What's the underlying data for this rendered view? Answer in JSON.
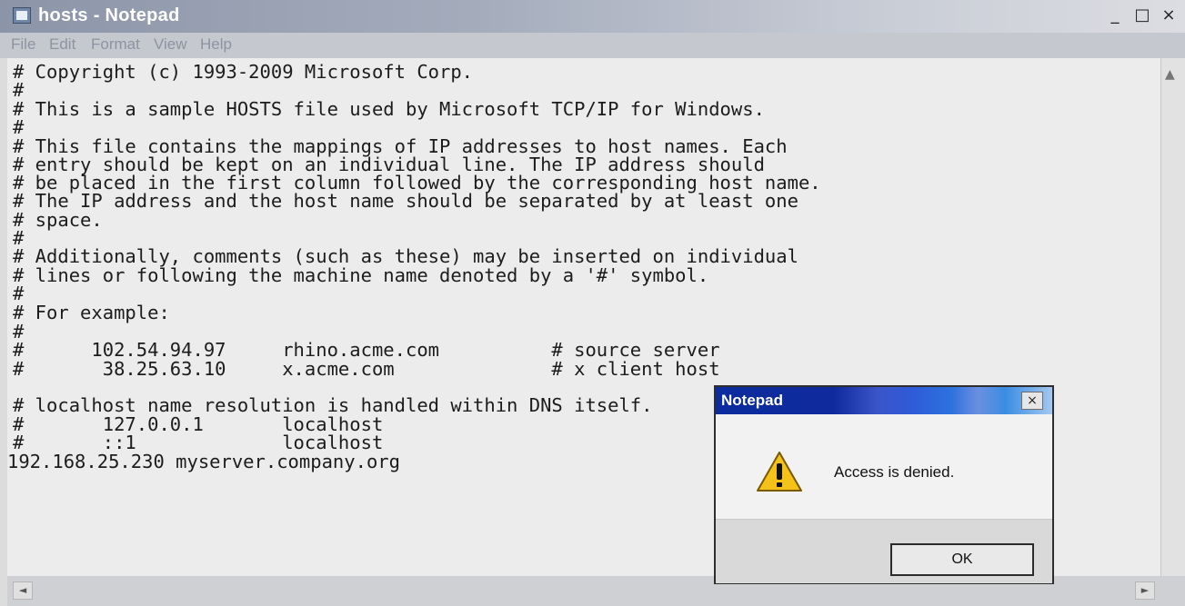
{
  "window": {
    "title": "hosts - Notepad",
    "controls": {
      "minimize": "_",
      "maximize": "□",
      "close": "×"
    }
  },
  "menu": [
    "File",
    "Edit",
    "Format",
    "View",
    "Help"
  ],
  "editor": {
    "lines": [
      "# Copyright (c) 1993-2009 Microsoft Corp.",
      "#",
      "# This is a sample HOSTS file used by Microsoft TCP/IP for Windows.",
      "#",
      "# This file contains the mappings of IP addresses to host names. Each",
      "# entry should be kept on an individual line. The IP address should",
      "# be placed in the first column followed by the corresponding host name.",
      "# The IP address and the host name should be separated by at least one",
      "# space.",
      "#",
      "# Additionally, comments (such as these) may be inserted on individual",
      "# lines or following the machine name denoted by a '#' symbol.",
      "#",
      "# For example:",
      "#",
      "#      102.54.94.97     rhino.acme.com          # source server",
      "#       38.25.63.10     x.acme.com              # x client host",
      "",
      "# localhost name resolution is handled within DNS itself.",
      "#       127.0.0.1       localhost",
      "#       ::1             localhost",
      "192.168.25.230 myserver.company.org"
    ]
  },
  "scrollbars": {
    "up_arrow": "▲",
    "left_arrow": "◄",
    "right_arrow": "►"
  },
  "dialog": {
    "title": "Notepad",
    "close": "×",
    "icon": "warning-icon",
    "message": "Access is denied.",
    "ok_label": "OK"
  }
}
